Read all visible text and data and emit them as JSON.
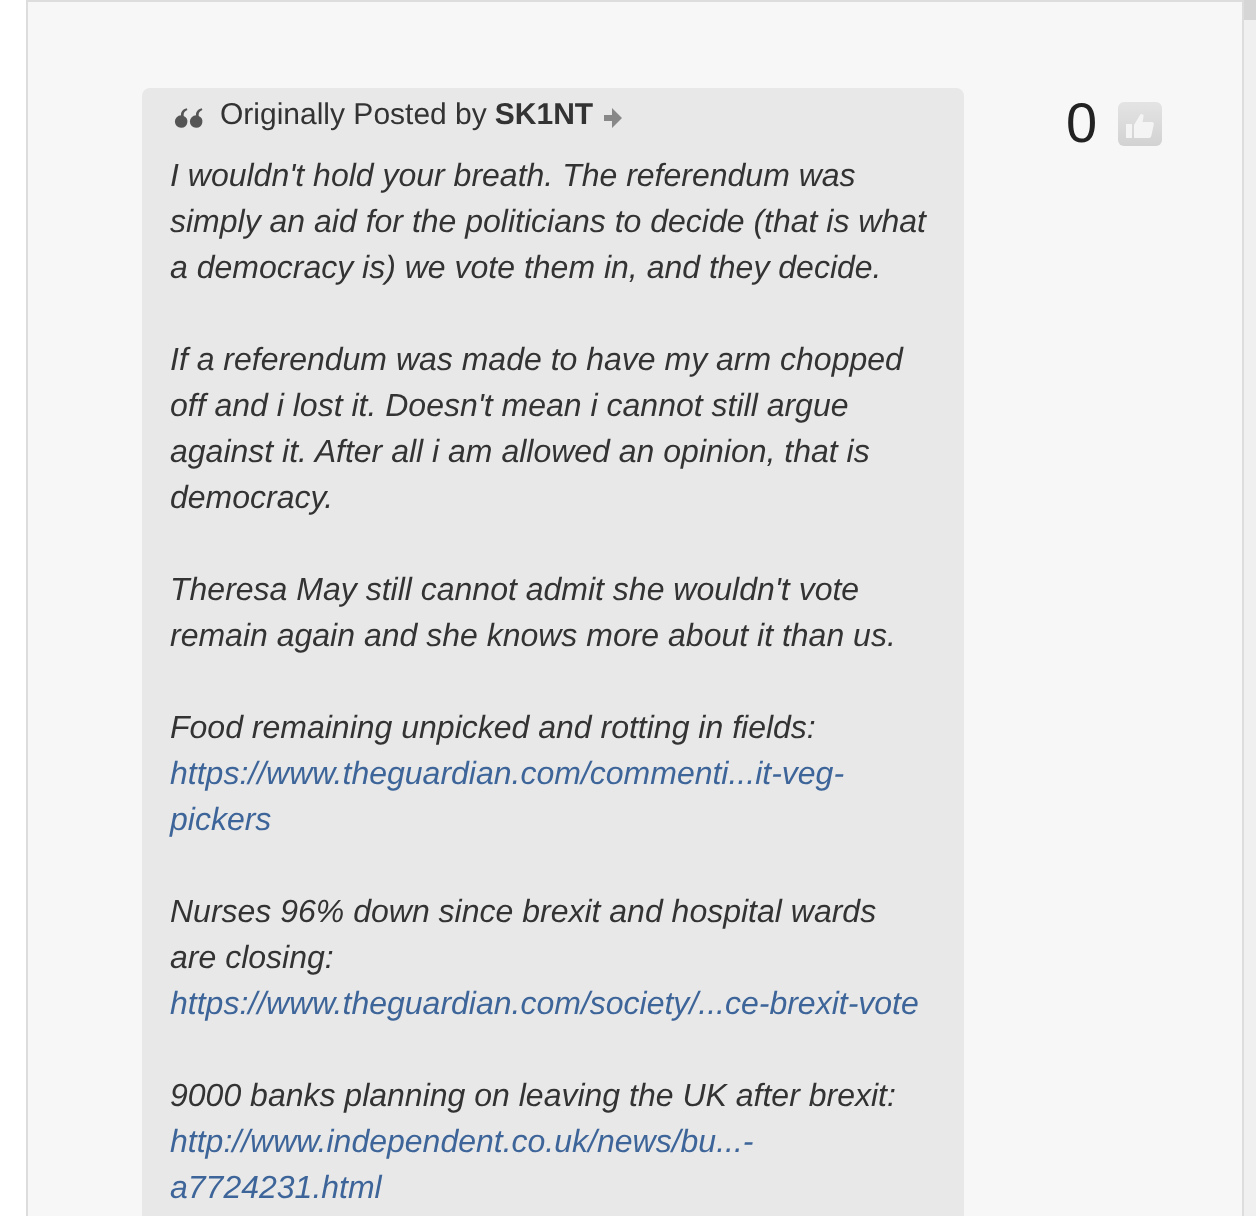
{
  "quote": {
    "prefix": "Originally Posted by",
    "author": "SK1NT",
    "paragraphs": [
      {
        "text": "I wouldn't hold your breath. The referendum was simply an aid for the politicians to decide (that is what a democracy is) we vote them in, and they decide."
      },
      {
        "text": "If a referendum was made to have my arm chopped off and i lost it. Doesn't mean i cannot still argue against it. After all i am allowed an opinion, that is democracy."
      },
      {
        "text": "Theresa May still cannot admit she wouldn't vote remain again and she knows more about it than us."
      },
      {
        "text": "Food remaining unpicked and rotting in fields:",
        "link": "https://www.theguardian.com/commenti...it-veg-pickers"
      },
      {
        "text": "Nurses 96% down since brexit and hospital wards are closing:",
        "link": "https://www.theguardian.com/society/...ce-brexit-vote"
      },
      {
        "text": "9000 banks planning on leaving the UK after brexit:",
        "link": "http://www.independent.co.uk/news/bu...-a7724231.html"
      }
    ]
  },
  "likes": {
    "count": "0"
  }
}
